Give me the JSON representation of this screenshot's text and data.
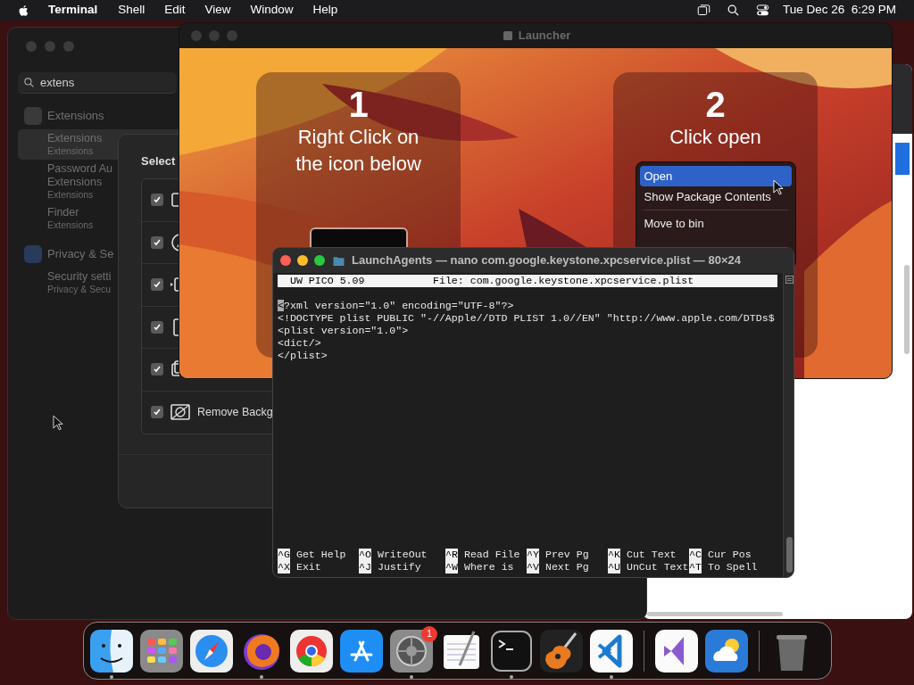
{
  "menu_bar": {
    "app": "Terminal",
    "menus": [
      "Shell",
      "Edit",
      "View",
      "Window",
      "Help"
    ],
    "clock": "Tue Dec 26  6:29 PM"
  },
  "settings_window": {
    "search": {
      "value": "extens"
    },
    "results": [
      {
        "kind": "header",
        "lines": [
          "Extensions"
        ]
      },
      {
        "kind": "item",
        "lines": [
          "Extensions"
        ],
        "subtitle": "Extensions",
        "selected": true
      },
      {
        "kind": "item",
        "lines": [
          "Password Au",
          "Extensions"
        ],
        "subtitle": "Extensions",
        "selected": false
      },
      {
        "kind": "item",
        "lines": [
          "Finder"
        ],
        "subtitle": "Extensions",
        "selected": false
      },
      {
        "kind": "header",
        "lines": [
          "Privacy & Se"
        ]
      },
      {
        "kind": "item",
        "lines": [
          "Security setti"
        ],
        "subtitle": "Privacy & Secu",
        "selected": false
      }
    ]
  },
  "sheet": {
    "title": "Select",
    "rows": [
      {
        "checked": true
      },
      {
        "checked": true
      },
      {
        "checked": true
      },
      {
        "checked": true
      },
      {
        "checked": true
      },
      {
        "checked": true,
        "label": "Remove Backg"
      }
    ]
  },
  "launcher": {
    "title": "Launcher",
    "steps": [
      {
        "number": "1",
        "text": "Right Click on the icon below"
      },
      {
        "number": "2",
        "text": "Click open"
      }
    ],
    "context_menu": [
      {
        "label": "Open",
        "selected": true
      },
      {
        "label": "Show Package Contents",
        "selected": false
      },
      {
        "label": "Move to bin",
        "selected": false
      }
    ]
  },
  "terminal": {
    "title": "LaunchAgents — nano com.google.keystone.xpcservice.plist — 80×24",
    "header_left": "UW PICO 5.09",
    "header_file": "File: com.google.keystone.xpcservice.plist",
    "lines": [
      "<?xml version=\"1.0\" encoding=\"UTF-8\"?>",
      "<!DOCTYPE plist PUBLIC \"-//Apple//DTD PLIST 1.0//EN\" \"http://www.apple.com/DTDs$",
      "<plist version=\"1.0\">",
      "<dict/>",
      "</plist>"
    ],
    "shortcuts": [
      {
        "key": "^G",
        "label": "Get Help"
      },
      {
        "key": "^O",
        "label": "WriteOut"
      },
      {
        "key": "^R",
        "label": "Read File"
      },
      {
        "key": "^Y",
        "label": "Prev Pg"
      },
      {
        "key": "^K",
        "label": "Cut Text"
      },
      {
        "key": "^C",
        "label": "Cur Pos"
      },
      {
        "key": "^X",
        "label": "Exit"
      },
      {
        "key": "^J",
        "label": "Justify"
      },
      {
        "key": "^W",
        "label": "Where is"
      },
      {
        "key": "^V",
        "label": "Next Pg"
      },
      {
        "key": "^U",
        "label": "UnCut Text"
      },
      {
        "key": "^T",
        "label": "To Spell"
      }
    ]
  },
  "dock": [
    {
      "kind": "finder",
      "running": true
    },
    {
      "kind": "launchpad",
      "running": false
    },
    {
      "kind": "safari",
      "running": false
    },
    {
      "kind": "firefox",
      "running": true
    },
    {
      "kind": "chrome",
      "running": false
    },
    {
      "kind": "appstore",
      "running": false
    },
    {
      "kind": "settings",
      "running": true,
      "badge": "1"
    },
    {
      "kind": "textedit",
      "running": false
    },
    {
      "kind": "terminal",
      "running": true
    },
    {
      "kind": "guitar",
      "running": false
    },
    {
      "kind": "vscode",
      "running": true
    },
    {
      "kind": "separator"
    },
    {
      "kind": "vstudio",
      "running": false
    },
    {
      "kind": "weather",
      "running": false
    },
    {
      "kind": "separator"
    },
    {
      "kind": "trash",
      "running": false
    }
  ]
}
